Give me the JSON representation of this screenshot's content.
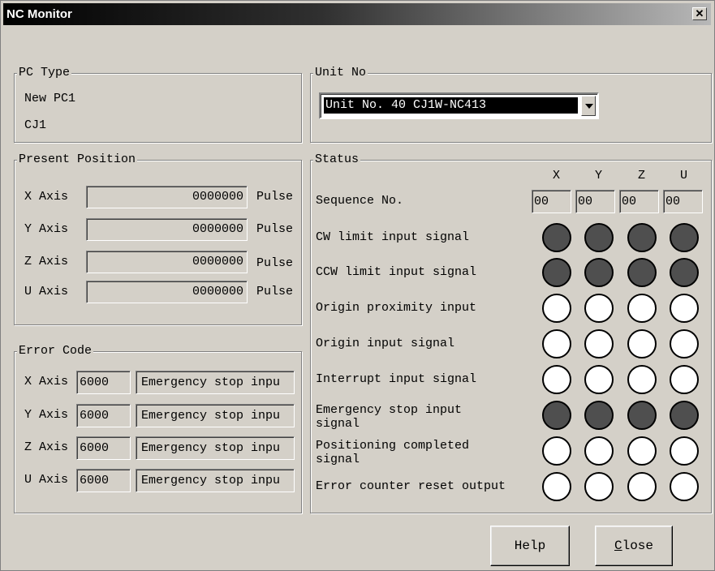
{
  "window": {
    "title": "NC Monitor",
    "close_glyph": "✕"
  },
  "pc_type": {
    "legend": "PC Type",
    "line1": "New PC1",
    "line2": "CJ1"
  },
  "unit_no": {
    "legend": "Unit No",
    "selected": "Unit No. 40 CJ1W-NC413"
  },
  "present_position": {
    "legend": "Present Position",
    "rows": [
      {
        "axis": "X Axis",
        "value": "0000000",
        "unit": "Pulse"
      },
      {
        "axis": "Y Axis",
        "value": "0000000",
        "unit": "Pulse"
      },
      {
        "axis": "Z Axis",
        "value": "0000000",
        "unit": "Pulse"
      },
      {
        "axis": "U Axis",
        "value": "0000000",
        "unit": "Pulse"
      }
    ]
  },
  "error_code": {
    "legend": "Error Code",
    "rows": [
      {
        "axis": "X Axis",
        "code": "6000",
        "message": "Emergency stop inpu"
      },
      {
        "axis": "Y Axis",
        "code": "6000",
        "message": "Emergency stop inpu"
      },
      {
        "axis": "Z Axis",
        "code": "6000",
        "message": "Emergency stop inpu"
      },
      {
        "axis": "U Axis",
        "code": "6000",
        "message": "Emergency stop inpu"
      }
    ]
  },
  "status": {
    "legend": "Status",
    "axes": [
      "X",
      "Y",
      "Z",
      "U"
    ],
    "sequence_label": "Sequence No.",
    "sequence_values": [
      "00",
      "00",
      "00",
      "00"
    ],
    "signals": [
      {
        "label": "CW limit input signal",
        "label2": "",
        "states": [
          true,
          true,
          true,
          true
        ]
      },
      {
        "label": "CCW limit input signal",
        "label2": "",
        "states": [
          true,
          true,
          true,
          true
        ]
      },
      {
        "label": "Origin proximity input",
        "label2": "",
        "states": [
          false,
          false,
          false,
          false
        ]
      },
      {
        "label": "Origin input signal",
        "label2": "",
        "states": [
          false,
          false,
          false,
          false
        ]
      },
      {
        "label": "Interrupt input signal",
        "label2": "",
        "states": [
          false,
          false,
          false,
          false
        ]
      },
      {
        "label": "Emergency stop input",
        "label2": "signal",
        "states": [
          true,
          true,
          true,
          true
        ]
      },
      {
        "label": "Positioning completed",
        "label2": "signal",
        "states": [
          false,
          false,
          false,
          false
        ]
      },
      {
        "label": "Error counter reset output",
        "label2": "",
        "states": [
          false,
          false,
          false,
          false
        ]
      }
    ]
  },
  "buttons": {
    "help": "Help",
    "close_mnemonic": "C",
    "close_rest": "lose"
  },
  "colors": {
    "led_on": "#4f4f4f",
    "led_off": "#ffffff",
    "face": "#d4d0c8"
  }
}
